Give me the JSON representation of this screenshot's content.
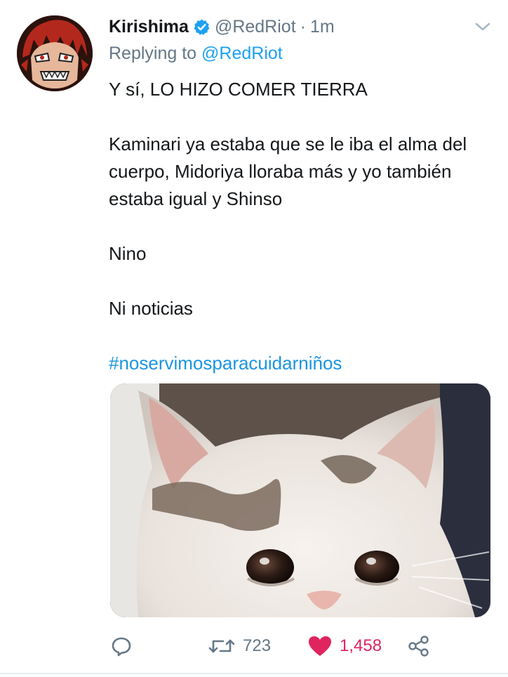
{
  "tweet": {
    "author": {
      "name": "Kirishima",
      "handle": "@RedRiot",
      "separator": "·",
      "time": "1m",
      "verified": true,
      "avatar_icon": "anime-avatar"
    },
    "reply_prefix": "Replying to",
    "reply_mention": "@RedRiot",
    "lines": [
      "Y sí, LO HIZO COMER TIERRA",
      "Kaminari ya estaba que se le iba el alma del cuerpo, Midoriya lloraba más y yo también estaba igual y Shinso",
      "Nino",
      "Ni noticias"
    ],
    "hashtag": "#noservimosparacuidarniños",
    "media_icon": "crying-cat-photo",
    "actions": {
      "reply_icon": "reply-icon",
      "retweet_icon": "retweet-icon",
      "retweet_count": "723",
      "like_icon": "heart-icon",
      "like_count": "1,458",
      "share_icon": "share-icon",
      "more_icon": "chevron-down-icon"
    },
    "colors": {
      "link": "#1da1f2",
      "like": "#e0245e",
      "secondary": "#657786",
      "verified": "#1da1f2"
    }
  }
}
